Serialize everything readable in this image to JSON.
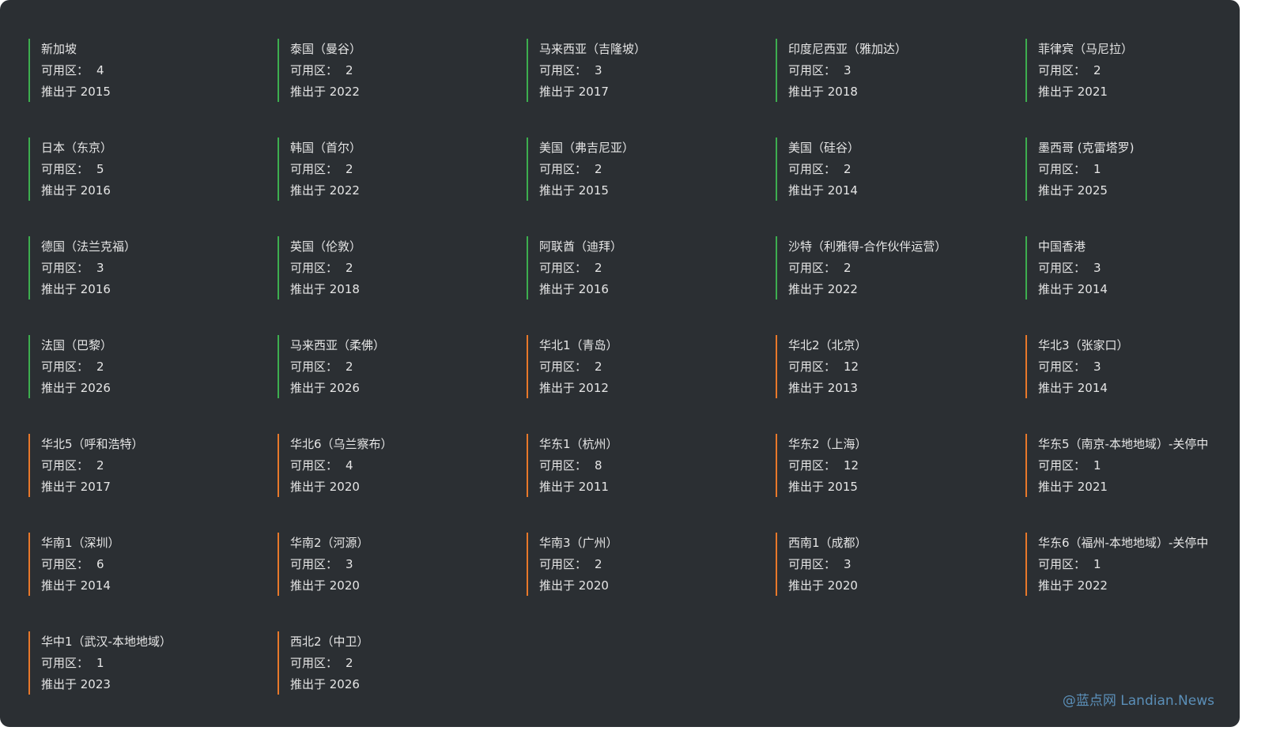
{
  "colors": {
    "background": "#2b2f33",
    "text": "#e6e6e6",
    "international_accent": "#3dae4f",
    "mainland_accent": "#e8782a",
    "watermark": "#5b8fb8"
  },
  "zones_label": "可用区：",
  "regions": [
    {
      "name": "新加坡",
      "zones": "4",
      "launched": "推出于 2015",
      "group": "international"
    },
    {
      "name": "泰国（曼谷）",
      "zones": "2",
      "launched": "推出于 2022",
      "group": "international"
    },
    {
      "name": "马来西亚（吉隆坡）",
      "zones": "3",
      "launched": "推出于 2017",
      "group": "international"
    },
    {
      "name": "印度尼西亚（雅加达）",
      "zones": "3",
      "launched": "推出于 2018",
      "group": "international"
    },
    {
      "name": "菲律宾（马尼拉）",
      "zones": "2",
      "launched": "推出于 2021",
      "group": "international"
    },
    {
      "name": "日本（东京）",
      "zones": "5",
      "launched": "推出于 2016",
      "group": "international"
    },
    {
      "name": "韩国（首尔）",
      "zones": "2",
      "launched": "推出于 2022",
      "group": "international"
    },
    {
      "name": "美国（弗吉尼亚）",
      "zones": "2",
      "launched": "推出于 2015",
      "group": "international"
    },
    {
      "name": "美国（硅谷）",
      "zones": "2",
      "launched": "推出于 2014",
      "group": "international"
    },
    {
      "name": "墨西哥 (克雷塔罗)",
      "zones": "1",
      "launched": "推出于 2025",
      "group": "international"
    },
    {
      "name": "德国（法兰克福）",
      "zones": "3",
      "launched": "推出于 2016",
      "group": "international"
    },
    {
      "name": "英国（伦敦）",
      "zones": "2",
      "launched": "推出于 2018",
      "group": "international"
    },
    {
      "name": "阿联酋（迪拜）",
      "zones": "2",
      "launched": "推出于 2016",
      "group": "international"
    },
    {
      "name": "沙特（利雅得-合作伙伴运营）",
      "zones": "2",
      "launched": "推出于 2022",
      "group": "international"
    },
    {
      "name": "中国香港",
      "zones": "3",
      "launched": "推出于 2014",
      "group": "international"
    },
    {
      "name": "法国（巴黎）",
      "zones": "2",
      "launched": "推出于 2026",
      "group": "international"
    },
    {
      "name": "马来西亚（柔佛）",
      "zones": "2",
      "launched": "推出于 2026",
      "group": "international"
    },
    {
      "name": "华北1（青岛）",
      "zones": "2",
      "launched": "推出于 2012",
      "group": "domestic"
    },
    {
      "name": "华北2（北京）",
      "zones": "12",
      "launched": "推出于 2013",
      "group": "domestic"
    },
    {
      "name": "华北3（张家口）",
      "zones": "3",
      "launched": "推出于 2014",
      "group": "domestic"
    },
    {
      "name": "华北5（呼和浩特）",
      "zones": "2",
      "launched": "推出于 2017",
      "group": "domestic"
    },
    {
      "name": "华北6（乌兰察布）",
      "zones": "4",
      "launched": "推出于 2020",
      "group": "domestic"
    },
    {
      "name": "华东1（杭州）",
      "zones": "8",
      "launched": "推出于 2011",
      "group": "domestic"
    },
    {
      "name": "华东2（上海）",
      "zones": "12",
      "launched": "推出于 2015",
      "group": "domestic"
    },
    {
      "name": "华东5（南京-本地地域）-关停中",
      "zones": "1",
      "launched": "推出于 2021",
      "group": "domestic"
    },
    {
      "name": "华南1（深圳）",
      "zones": "6",
      "launched": "推出于 2014",
      "group": "domestic"
    },
    {
      "name": "华南2（河源）",
      "zones": "3",
      "launched": "推出于 2020",
      "group": "domestic"
    },
    {
      "name": "华南3（广州）",
      "zones": "2",
      "launched": "推出于 2020",
      "group": "domestic"
    },
    {
      "name": "西南1（成都）",
      "zones": "3",
      "launched": "推出于 2020",
      "group": "domestic"
    },
    {
      "name": "华东6（福州-本地地域）-关停中",
      "zones": "1",
      "launched": "推出于 2022",
      "group": "domestic"
    },
    {
      "name": "华中1（武汉-本地地域）",
      "zones": "1",
      "launched": "推出于 2023",
      "group": "domestic"
    },
    {
      "name": "西北2（中卫）",
      "zones": "2",
      "launched": "推出于 2026",
      "group": "domestic"
    }
  ],
  "watermark": "@蓝点网 Landian.News"
}
